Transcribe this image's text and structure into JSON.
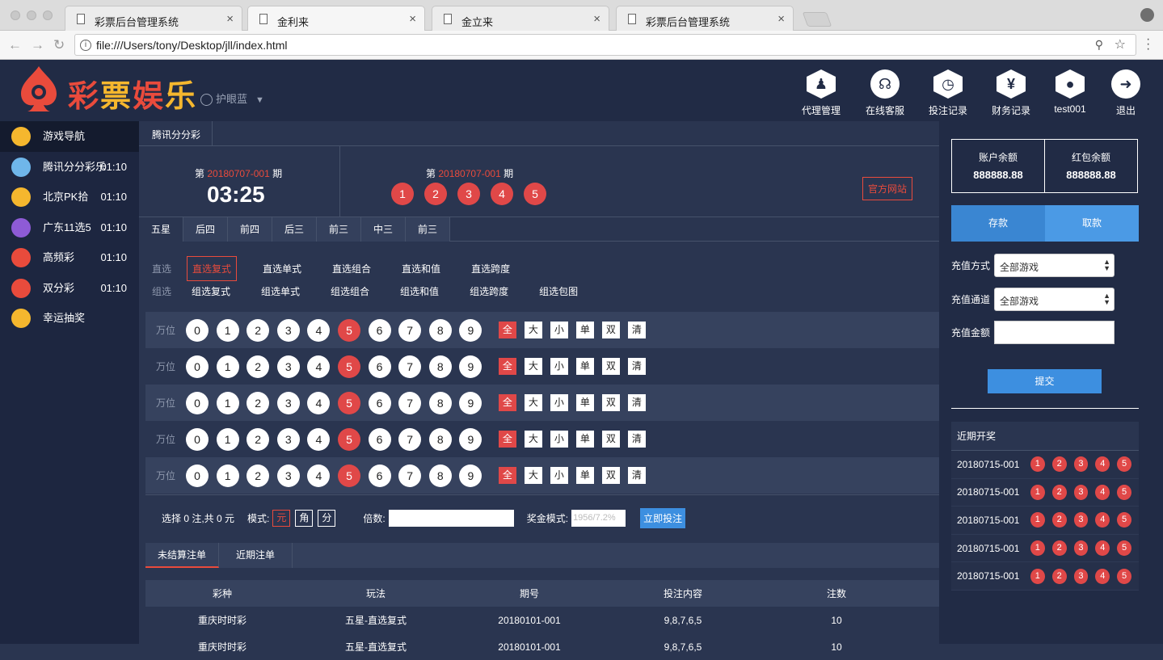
{
  "browser": {
    "tabs": [
      {
        "title": "彩票后台管理系统"
      },
      {
        "title": "金利来"
      },
      {
        "title": "金立来"
      },
      {
        "title": "彩票后台管理系统"
      }
    ],
    "url": "file:///Users/tony/Desktop/jll/index.html"
  },
  "header": {
    "logo_text": [
      "彩",
      "票",
      "娱",
      "乐"
    ],
    "eye_mode": "护眼蓝",
    "nav": [
      {
        "label": "代理管理",
        "icon": "agent-icon"
      },
      {
        "label": "在线客服",
        "icon": "headset-icon"
      },
      {
        "label": "投注记录",
        "icon": "clock-icon"
      },
      {
        "label": "财务记录",
        "icon": "yen-icon"
      },
      {
        "label": "test001",
        "icon": "user-icon"
      },
      {
        "label": "退出",
        "icon": "logout-arrow-icon"
      }
    ]
  },
  "sidebar": {
    "items": [
      {
        "label": "游戏导航",
        "time": "",
        "color": "#f5b72e"
      },
      {
        "label": "腾讯分分彩乐",
        "time": "01:10",
        "color": "#6fb6ea"
      },
      {
        "label": "北京PK拾",
        "time": "01:10",
        "color": "#f5b72e"
      },
      {
        "label": "广东11选5",
        "time": "01:10",
        "color": "#8e5bd6"
      },
      {
        "label": "高频彩",
        "time": "01:10",
        "color": "#e94b3c"
      },
      {
        "label": "双分彩",
        "time": "01:10",
        "color": "#e94b3c"
      },
      {
        "label": "幸运抽奖",
        "time": "",
        "color": "#f5b72e"
      }
    ]
  },
  "game": {
    "tab": "腾讯分分彩",
    "current": {
      "prefix": "第",
      "period": "20180707-001",
      "suffix": "期",
      "countdown": "03:25"
    },
    "last": {
      "prefix": "第",
      "period": "20180707-001",
      "suffix": "期",
      "balls": [
        "1",
        "2",
        "3",
        "4",
        "5"
      ]
    },
    "official_site": "官方网站",
    "play_tabs": [
      "五星",
      "后四",
      "前四",
      "后三",
      "前三",
      "中三",
      "前三"
    ],
    "direct": {
      "label": "直选",
      "options": [
        "直选复式",
        "直选单式",
        "直选组合",
        "直选和值",
        "直选跨度"
      ]
    },
    "group": {
      "label": "组选",
      "options": [
        "组选复式",
        "组选单式",
        "组选组合",
        "组选和值",
        "组选跨度",
        "组选包图"
      ]
    },
    "digit_rows": [
      {
        "pos": "万位"
      },
      {
        "pos": "万位"
      },
      {
        "pos": "万位"
      },
      {
        "pos": "万位"
      },
      {
        "pos": "万位"
      }
    ],
    "digits": [
      "0",
      "1",
      "2",
      "3",
      "4",
      "5",
      "6",
      "7",
      "8",
      "9"
    ],
    "selected_digit": "5",
    "quick": [
      "全",
      "大",
      "小",
      "单",
      "双",
      "清"
    ]
  },
  "betbar": {
    "summary": "选择 0 注,共 0 元",
    "mode_label": "模式:",
    "modes": [
      "元",
      "角",
      "分"
    ],
    "multiple_label": "倍数:",
    "prize_label": "奖金模式:",
    "prize_placeholder": "1956/7.2%",
    "submit": "立即投注"
  },
  "orders": {
    "tabs": [
      "未结算注单",
      "近期注单"
    ],
    "columns": [
      "彩种",
      "玩法",
      "期号",
      "投注内容",
      "注数"
    ],
    "rows": [
      [
        "重庆时时彩",
        "五星-直选复式",
        "20180101-001",
        "9,8,7,6,5",
        "10"
      ],
      [
        "重庆时时彩",
        "五星-直选复式",
        "20180101-001",
        "9,8,7,6,5",
        "10"
      ]
    ]
  },
  "account": {
    "balance_label": "账户余额",
    "balance": "888888.88",
    "redpack_label": "红包余额",
    "redpack": "888888.88",
    "deposit": "存款",
    "withdraw": "取款",
    "recharge_method_label": "充值方式",
    "recharge_method": "全部游戏",
    "recharge_channel_label": "充值通道",
    "recharge_channel": "全部游戏",
    "recharge_amount_label": "充值金额",
    "submit": "提交"
  },
  "recent": {
    "title": "近期开奖",
    "rows": [
      {
        "period": "20180715-001",
        "balls": [
          "1",
          "2",
          "3",
          "4",
          "5"
        ]
      },
      {
        "period": "20180715-001",
        "balls": [
          "1",
          "2",
          "3",
          "4",
          "5"
        ]
      },
      {
        "period": "20180715-001",
        "balls": [
          "1",
          "2",
          "3",
          "4",
          "5"
        ]
      },
      {
        "period": "20180715-001",
        "balls": [
          "1",
          "2",
          "3",
          "4",
          "5"
        ]
      },
      {
        "period": "20180715-001",
        "balls": [
          "1",
          "2",
          "3",
          "4",
          "5"
        ]
      }
    ]
  }
}
